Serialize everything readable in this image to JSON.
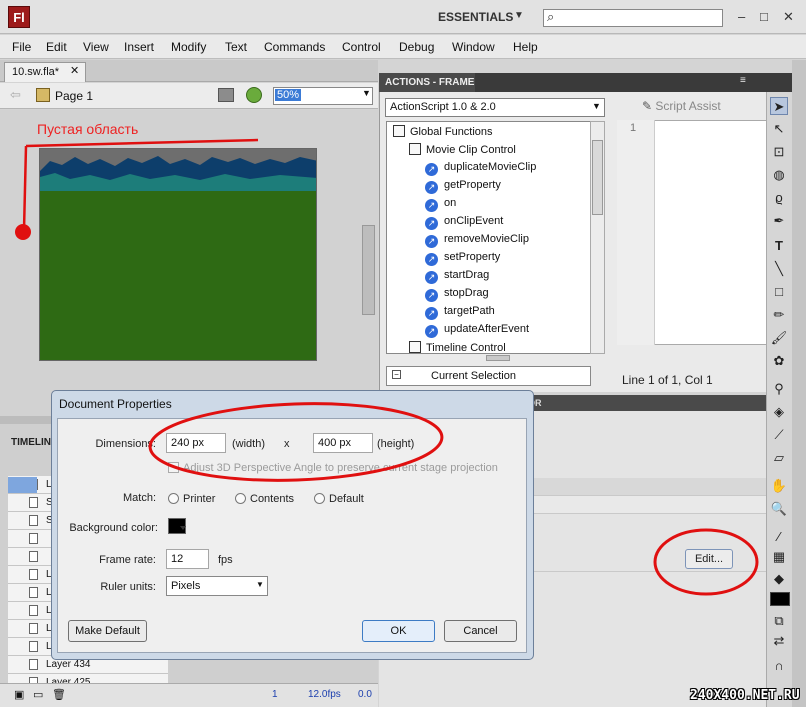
{
  "app": {
    "logo": "Fl",
    "workspace": "ESSENTIALS",
    "search_placeholder": ""
  },
  "window": {
    "minimize": "–",
    "maximize": "□",
    "close": "✕"
  },
  "menu": [
    "File",
    "Edit",
    "View",
    "Insert",
    "Modify",
    "Text",
    "Commands",
    "Control",
    "Debug",
    "Window",
    "Help"
  ],
  "document": {
    "tab": "10.sw.fla*",
    "scene": "Page 1",
    "zoom": "50%"
  },
  "annotation": {
    "label": "Пустая область",
    "color": "#ee2222"
  },
  "actions": {
    "panel_title": "ACTIONS - FRAME",
    "version": "ActionScript 1.0 & 2.0",
    "script_assist": "Script Assist",
    "line_number": "1",
    "status": "Line 1 of 1, Col 1",
    "current_selection": "Current Selection",
    "tree": {
      "global": "Global Functions",
      "movie_clip_control": "Movie Clip Control",
      "functions": [
        "duplicateMovieClip",
        "getProperty",
        "on",
        "onClipEvent",
        "removeMovieClip",
        "setProperty",
        "startDrag",
        "stopDrag",
        "targetPath",
        "updateAfterEvent"
      ],
      "timeline_control": "Timeline Control"
    }
  },
  "properties_tab": "OR",
  "timeline": {
    "label": "TIMELIN",
    "layers": [
      "L",
      "S",
      "S",
      "",
      "",
      "L",
      "L",
      "L",
      "L",
      "L",
      "Layer 434",
      "Layer 425"
    ],
    "current_frame": "1",
    "fps": "12.0fps",
    "time": "0.0"
  },
  "edit_button": "Edit...",
  "dialog": {
    "title": "Document Properties",
    "dimensions_label": "Dimensions:",
    "width_value": "240 px",
    "width_caption": "(width)",
    "x_separator": "x",
    "height_value": "400 px",
    "height_caption": "(height)",
    "adjust_3d": "Adjust 3D Perspective Angle to preserve current stage projection",
    "match_label": "Match:",
    "match_options": [
      "Printer",
      "Contents",
      "Default"
    ],
    "bg_label": "Background color:",
    "bg_color": "#000000",
    "framerate_label": "Frame rate:",
    "framerate_value": "12",
    "fps_unit": "fps",
    "ruler_label": "Ruler units:",
    "ruler_value": "Pixels",
    "make_default": "Make Default",
    "ok": "OK",
    "cancel": "Cancel"
  },
  "colors": {
    "stage_green": "#2e6a14",
    "highlight_red": "#e01010",
    "header_dark": "#4a4a4a"
  },
  "watermark": "240X400.NET.RU"
}
